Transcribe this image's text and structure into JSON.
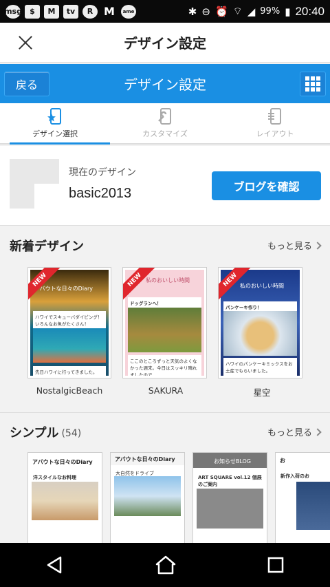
{
  "status_bar": {
    "app_icons": [
      "msg",
      "$",
      "M",
      "tv",
      "R",
      "M",
      "ame"
    ],
    "battery": "99%",
    "time": "20:40"
  },
  "top_bar": {
    "title": "デザイン設定"
  },
  "header": {
    "back_label": "戻る",
    "title": "デザイン設定"
  },
  "tabs": [
    {
      "label": "デザイン選択",
      "icon": "phone-star-icon",
      "active": true
    },
    {
      "label": "カスタマイズ",
      "icon": "phone-wrench-icon",
      "active": false
    },
    {
      "label": "レイアウト",
      "icon": "phone-layout-icon",
      "active": false
    }
  ],
  "current": {
    "label": "現在のデザイン",
    "name": "basic2013",
    "confirm_label": "ブログを確認"
  },
  "new_designs": {
    "title": "新着デザイン",
    "more_label": "もっと見る",
    "items": [
      {
        "name": "NostalgicBeach",
        "badge": "NEW",
        "blog_title": "アバウトな日々のDiary",
        "post_text": "ハワイでスキューバダイビング！いろんなお魚がたくさん！",
        "footer": "先日ハワイに行ってきました。"
      },
      {
        "name": "SAKURA",
        "badge": "NEW",
        "blog_title": "私のおいしい時間",
        "post_title": "ドッグランへ！",
        "post_text": "ここのところずっと天気のよくなかった週末。今日はスッキリ晴れましたので..."
      },
      {
        "name": "星空",
        "badge": "NEW",
        "blog_title": "私のおいしい時間",
        "post_title": "パンケーキ作り！",
        "post_text": "ハワイのパンケーキミックスをお土産でもらいました。"
      }
    ]
  },
  "simple": {
    "title": "シンプル",
    "count": "(54)",
    "more_label": "もっと見る",
    "items": [
      {
        "blog_title": "アバウトな日々のDiary",
        "post_title": "洋スタイルなお料理"
      },
      {
        "blog_title": "アバウトな日々のDiary",
        "post_title": "大自然をドライブ"
      },
      {
        "blog_title": "お知らせBLOG",
        "post_title": "ART SQUARE vol.12 個展のご案内"
      },
      {
        "blog_title": "お",
        "post_title": "新作入荷のお"
      }
    ]
  },
  "colors": {
    "accent": "#1a8fe3",
    "badge": "#e0262d"
  }
}
